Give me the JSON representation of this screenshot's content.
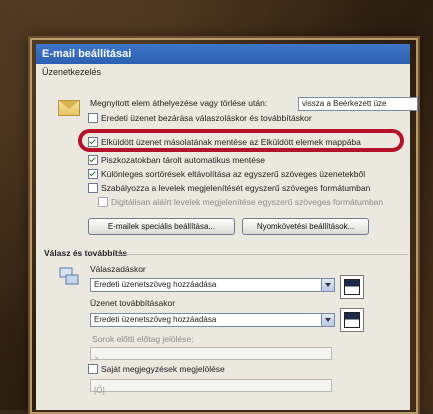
{
  "window": {
    "title": "E-mail beállításai"
  },
  "sections": {
    "messages": "Üzenetkezelés",
    "replies": "Válasz és továbbítás"
  },
  "options": {
    "move_label": "Megnyitott elem áthelyezése vagy törlése után:",
    "move_value": "vissza a Beérkezett üze",
    "close_original": "Eredeti üzenet bezárása válaszoláskor és továbbításkor",
    "save_copies_sent": "Elküldött üzenet másolatának mentése az Elküldött elemek mappába",
    "autosave": "Piszkozatokban tárolt automatikus mentése",
    "remove_extra_line_breaks": "Különleges sortörések eltávolítása az egyszerű szöveges üzenetekből",
    "read_plain_text": "Szabályozza a levelek megjelenítését egyszerű szöveges formátumban",
    "digitally_signed": "Digitálisan aláírt levelek megjelenítése egyszerű szöveges formátumban"
  },
  "buttons": {
    "advanced": "E-mailek speciális beállítása...",
    "tracking": "Nyomkövetési beállítások..."
  },
  "reply": {
    "replies_label": "Válaszadáskor",
    "replies_value": "Eredeti üzenetszöveg hozzáadása",
    "forward_label": "Üzenet továbbításakor",
    "forward_value": "Eredeti üzenetszöveg hozzáadása",
    "prefix_label": "Sorok előtti előtag jelölése:",
    "prefix_value": ">",
    "mark_comments": "Saját megjegyzések megjelölése",
    "comment_value": "[Ő]"
  }
}
